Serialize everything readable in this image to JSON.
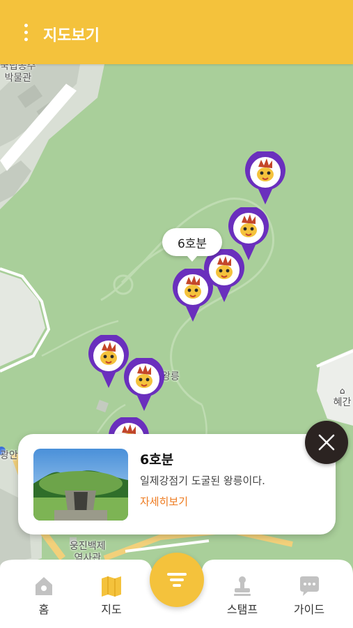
{
  "header": {
    "title": "지도보기",
    "background": "#f4c23c"
  },
  "map": {
    "labels": {
      "museum": "국립공주\n박물관",
      "royal_tomb_suffix": "왕릉",
      "hyegan_short": "혜간",
      "ungjin": "웅진백제\n역사관",
      "left_edge": "광안"
    },
    "markers": [
      {
        "icon": "mascot-pin-icon",
        "selected": false
      },
      {
        "icon": "mascot-pin-icon",
        "selected": false
      },
      {
        "icon": "mascot-pin-icon",
        "selected": false
      },
      {
        "icon": "mascot-pin-icon",
        "selected": true
      },
      {
        "icon": "mascot-pin-icon",
        "selected": false
      },
      {
        "icon": "mascot-pin-icon",
        "selected": false
      },
      {
        "icon": "mascot-pin-icon",
        "selected": false
      }
    ],
    "marker_color": "#6a2fbd",
    "selected_callout": "6호분"
  },
  "info_card": {
    "title": "6호분",
    "description": "일제강점기 도굴된 왕릉이다.",
    "link_label": "자세히보기",
    "link_color": "#ee7a1e"
  },
  "bottom_nav": {
    "items": [
      {
        "label": "홈",
        "icon": "home-icon"
      },
      {
        "label": "지도",
        "icon": "map-icon"
      },
      {
        "label": "스탬프",
        "icon": "stamp-icon"
      },
      {
        "label": "가이드",
        "icon": "chat-guide-icon"
      }
    ],
    "center_button_icon": "list-filter-icon"
  }
}
